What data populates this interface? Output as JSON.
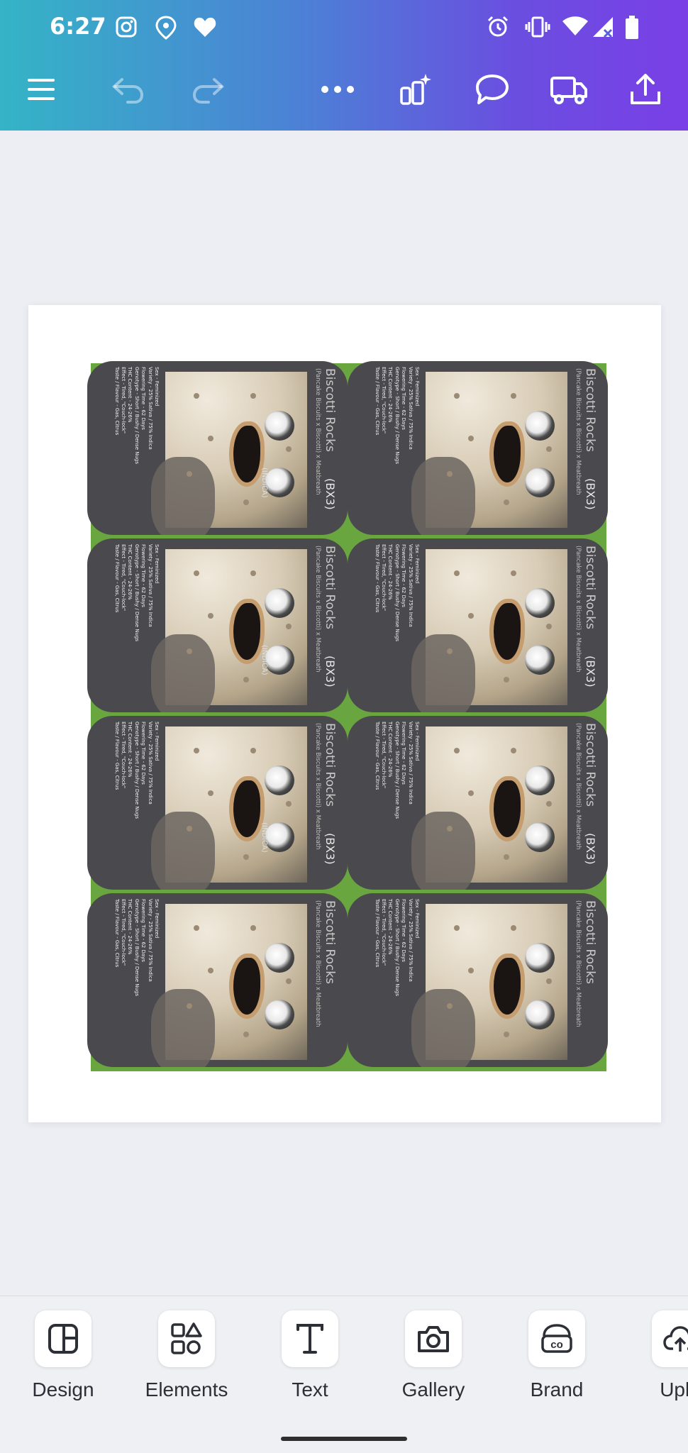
{
  "status_bar": {
    "time": "6:27",
    "left_icons": [
      "instagram-icon",
      "location-pin-icon",
      "heart-icon"
    ],
    "right_icons": [
      "alarm-icon",
      "vibrate-icon",
      "wifi-icon",
      "signal-icon",
      "battery-icon"
    ]
  },
  "toolbar": {
    "items": [
      "menu-icon",
      "undo-icon",
      "redo-icon",
      "more-icon",
      "magic-edit-icon",
      "comment-icon",
      "truck-icon",
      "share-icon"
    ]
  },
  "card": {
    "title": "Biscotti Rocks",
    "code": "(BX3)",
    "parents": "(Pancake Biscuits x Biscotti) x Meatbreath",
    "variety": "(INDICA)",
    "details": [
      "Sex - Feminized",
      "Variety - 25% Sativa / 75% Indica",
      "Flowering Time - 62 Days",
      "Genotype - Short / Bushy / Dense Nugs",
      "THC Content - 24-26%",
      "Effect - Tired, \"Couch-lock\"",
      "Taste / Flavour - Gas, Citrus"
    ]
  },
  "bottom_tools": [
    {
      "label": "Design",
      "icon": "design-icon"
    },
    {
      "label": "Elements",
      "icon": "elements-icon"
    },
    {
      "label": "Text",
      "icon": "text-icon"
    },
    {
      "label": "Gallery",
      "icon": "camera-icon"
    },
    {
      "label": "Brand",
      "icon": "brand-icon"
    },
    {
      "label": "Uplo",
      "icon": "upload-icon"
    }
  ],
  "colors": {
    "topbar_gradient_start": "#34b4c6",
    "topbar_gradient_end": "#7a3fe6",
    "sheet_background": "#6aa640",
    "card_background": "#4a4a4e"
  }
}
